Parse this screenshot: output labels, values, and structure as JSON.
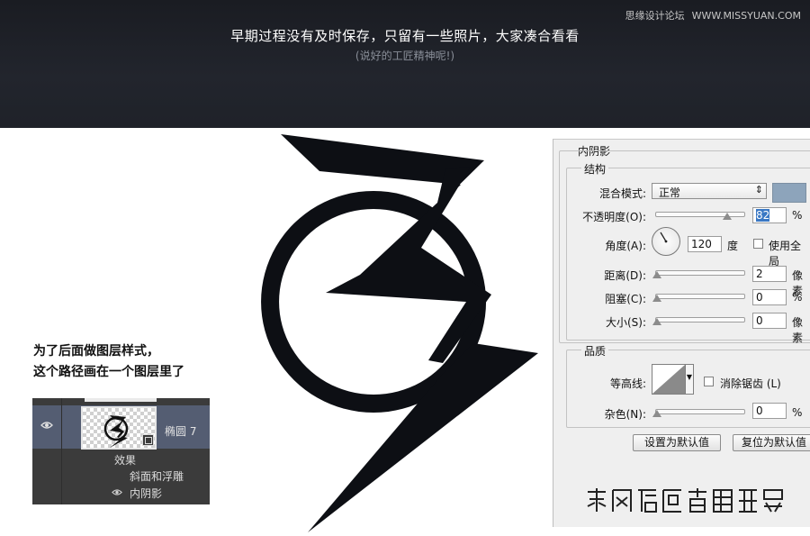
{
  "banner": {
    "title": "早期过程没有及时保存，只留有一些照片，大家凑合看看",
    "subtitle": "(说好的工匠精神呢!)",
    "watermark_site": "思缘设计论坛",
    "watermark_url": "WWW.MISSYUAN.COM"
  },
  "note": {
    "line1": "为了后面做图层样式，",
    "line2": "这个路径画在一个图层里了"
  },
  "layers_panel": {
    "layer_name": "椭圆 7",
    "effects_label": "效果",
    "effects": [
      "斜面和浮雕",
      "内阴影"
    ]
  },
  "dialog": {
    "title": "内阴影",
    "structure": {
      "legend": "结构",
      "blend_mode_label": "混合模式:",
      "blend_mode_value": "正常",
      "shadow_color": "#8da4bb",
      "opacity_label": "不透明度(O):",
      "opacity_value": "82",
      "opacity_unit": "%",
      "angle_label": "角度(A):",
      "angle_value": "120",
      "angle_unit": "度",
      "global_light_label": "使用全局",
      "distance_label": "距离(D):",
      "distance_value": "2",
      "distance_unit": "像素",
      "choke_label": "阻塞(C):",
      "choke_value": "0",
      "choke_unit": "%",
      "size_label": "大小(S):",
      "size_value": "0",
      "size_unit": "像素"
    },
    "quality": {
      "legend": "品质",
      "contour_label": "等高线:",
      "antialias_label": "消除锯齿 (L)",
      "noise_label": "杂色(N):",
      "noise_value": "0",
      "noise_unit": "%"
    },
    "buttons": {
      "make_default": "设置为默认值",
      "reset_default": "复位为默认值"
    }
  },
  "colors": {
    "banner_bg": "#1e2027",
    "logo_fill": "#0d0f14",
    "layer_selected": "#545d72",
    "selection_blue": "#3a78c4"
  }
}
